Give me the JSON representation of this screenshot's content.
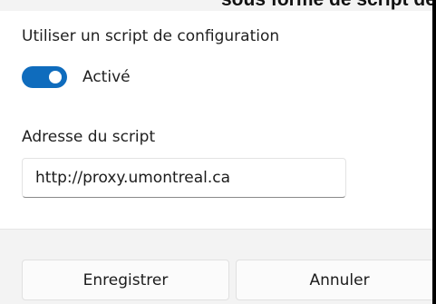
{
  "header": {
    "title_fragment": "sous forme de script de configuration"
  },
  "proxy_script": {
    "setting_label": "Utiliser un script de configuration",
    "toggle_state": "Activé",
    "toggle_on": true,
    "address_label": "Adresse du script",
    "address_value": "http://proxy.umontreal.ca"
  },
  "footer": {
    "save_label": "Enregistrer",
    "cancel_label": "Annuler"
  },
  "colors": {
    "accent": "#0f6cbd",
    "content_bg": "#ffffff",
    "footer_bg": "#f3f3f3"
  }
}
